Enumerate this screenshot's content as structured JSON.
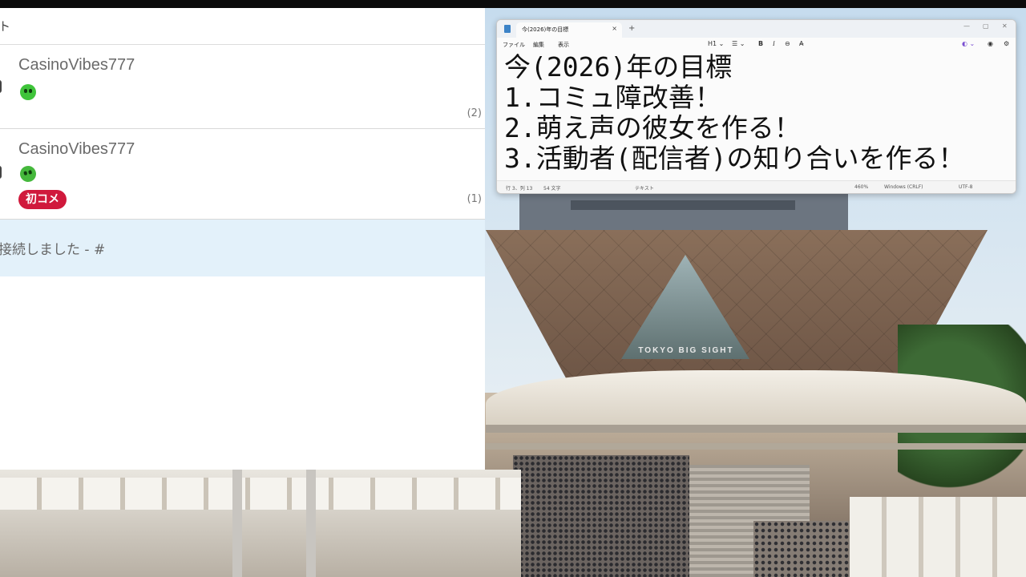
{
  "chat": {
    "header_label": "ト",
    "messages": [
      {
        "username": "CasinoVibes777",
        "count": "(2)",
        "badge": ""
      },
      {
        "username": "CasinoVibes777",
        "count": "(1)",
        "badge": "初コメ"
      }
    ],
    "status_text": "接続しました - #"
  },
  "notepad": {
    "tab_title": "今(2026)年の目標",
    "tab_close": "×",
    "tab_add": "+",
    "window_controls": {
      "minimize": "—",
      "maximize": "▢",
      "close": "✕"
    },
    "menu": [
      "ファイル",
      "編集",
      "表示"
    ],
    "toolbar": {
      "heading": "H1 ⌄",
      "list": "☰ ⌄",
      "bold": "B",
      "italic": "I",
      "link": "⊖",
      "clear_format": "A̶",
      "copilot": "◐ ⌄",
      "account": "◉",
      "settings": "⚙"
    },
    "lines": [
      "今(2026)年の目標",
      "1.コミュ障改善！",
      "2.萌え声の彼女を作る！",
      "3.活動者(配信者)の知り合いを作る！"
    ],
    "status": {
      "position": "行 3、列 13",
      "chars": "54 文字",
      "mode": "テキスト",
      "zoom": "460%",
      "line_ending": "Windows (CRLF)",
      "encoding": "UTF-8"
    }
  },
  "scene": {
    "sign_text": "TOKYO BIG SIGHT"
  },
  "colors": {
    "badge": "#d0193c",
    "emote": "#3fc43a",
    "status_bg": "#e3f1fa"
  }
}
